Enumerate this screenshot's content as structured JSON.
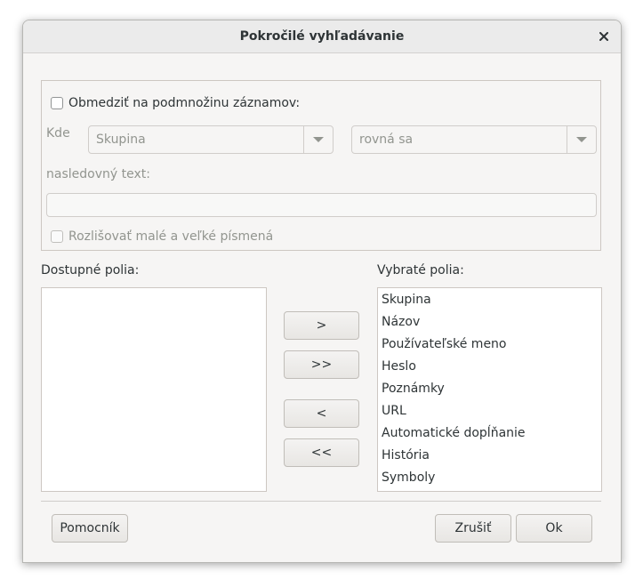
{
  "dialog": {
    "title": "Pokročilé vyhľadávanie"
  },
  "filter": {
    "restrict_label": "Obmedziť na podmnožinu záznamov:",
    "restrict_checked": false,
    "where_label": "Kde",
    "field_combo_value": "Skupina",
    "condition_combo_value": "rovná sa",
    "text_label": "nasledovný text:",
    "text_value": "",
    "case_label": "Rozlišovať malé a veľké písmená",
    "case_checked": false
  },
  "available": {
    "label": "Dostupné polia:",
    "items": []
  },
  "selected": {
    "label": "Vybraté polia:",
    "items": [
      "Skupina",
      "Názov",
      "Používateľské meno",
      "Heslo",
      "Poznámky",
      "URL",
      "Automatické dopĺňanie",
      "História",
      "Symboly"
    ]
  },
  "transfer": {
    "add": ">",
    "add_all": ">>",
    "remove": "<",
    "remove_all": "<<"
  },
  "footer": {
    "help": "Pomocník",
    "cancel": "Zrušiť",
    "ok": "Ok"
  },
  "icons": {
    "close": "close-icon",
    "dropdown": "chevron-down-icon"
  }
}
